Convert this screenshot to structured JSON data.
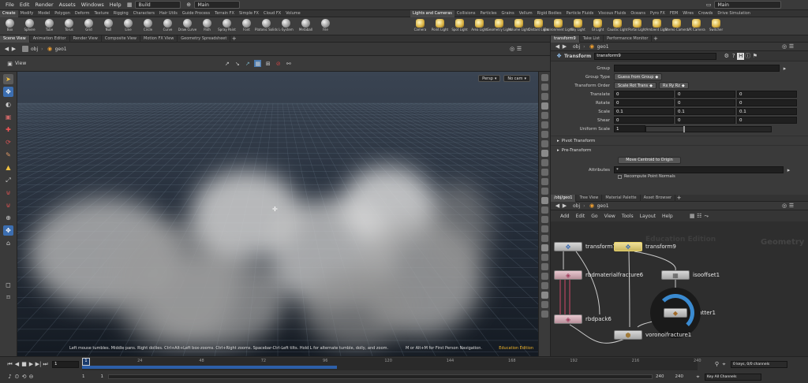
{
  "menubar": {
    "items": [
      "File",
      "Edit",
      "Render",
      "Assets",
      "Windows",
      "Help"
    ],
    "build": "Build",
    "desktop": "Main",
    "right_desktop": "Main"
  },
  "shelf": {
    "left_tabs": [
      "Create",
      "Modify",
      "Model",
      "Polygon",
      "Deform",
      "Texture",
      "Rigging",
      "Characters",
      "Hair Utils",
      "Guide Process",
      "Terrain FX",
      "Simple FX",
      "Cloud FX",
      "Volume"
    ],
    "right_tabs": [
      "Lights and Cameras",
      "Collisions",
      "Particles",
      "Grains",
      "Vellum",
      "Rigid Bodies",
      "Particle Fluids",
      "Viscous Fluids",
      "Oceans",
      "Pyro FX",
      "FEM",
      "Wires",
      "Crowds",
      "Drive Simulation"
    ],
    "left_tools": [
      "Box",
      "Sphere",
      "Tube",
      "Torus",
      "Grid",
      "Null",
      "Line",
      "Circle",
      "Curve",
      "Draw Curve",
      "Path",
      "Spray Paint",
      "Font",
      "Platonic Solids",
      "L-System",
      "Metaball",
      "File"
    ],
    "right_tools": [
      "Camera",
      "Point Light",
      "Spot Light",
      "Area Light",
      "Geometry Light",
      "Volume Light",
      "Distant Light",
      "Environment Light",
      "Sky Light",
      "GI Light",
      "Caustic Light",
      "Portal Light",
      "Ambient Light",
      "Stereo Camera",
      "VR Camera",
      "Switcher"
    ]
  },
  "left_panes": {
    "tabs": [
      "Scene View",
      "Animation Editor",
      "Render View",
      "Composite View",
      "Motion FX View",
      "Geometry Spreadsheet"
    ],
    "path": [
      "obj",
      "geo1"
    ]
  },
  "viewport": {
    "label": "View",
    "persp": "Persp",
    "cam": "No cam",
    "hint": "Left mouse tumbles. Middle pans. Right dollies. Ctrl+Alt+Left box-zooms. Ctrl+Right zooms. Spacebar-Ctrl-Left tilts. Hold L for alternate tumble, dolly, and zoom.",
    "hint2": "M or Alt+M for First Person Navigation.",
    "edition": "Education Edition"
  },
  "params_pane": {
    "tabs": [
      "transform9",
      "Take List",
      "Performance Monitor"
    ],
    "path": [
      "obj",
      "geo1"
    ],
    "node_type": "Transform",
    "node_name": "transform9",
    "group_label": "Group",
    "group_value": "",
    "group_type_label": "Group Type",
    "group_type_value": "Guess from Group",
    "order_label": "Transform Order",
    "order_value": "Scale Rot Trans",
    "rot_order": "Rx Ry Rz",
    "vectors": [
      {
        "label": "Translate",
        "x": "0",
        "y": "0",
        "z": "0"
      },
      {
        "label": "Rotate",
        "x": "0",
        "y": "0",
        "z": "0"
      },
      {
        "label": "Scale",
        "x": "0.1",
        "y": "0.1",
        "z": "0.1"
      },
      {
        "label": "Shear",
        "x": "0",
        "y": "0",
        "z": "0"
      }
    ],
    "uniform_label": "Uniform Scale",
    "uniform_value": "1",
    "uniform_level": 0.3,
    "pivot": "Pivot Transform",
    "pre": "Pre-Transform",
    "centroid_btn": "Move Centroid to Origin",
    "attributes_label": "Attributes",
    "attributes_value": "*",
    "recompute": "Recompute Point Normals"
  },
  "network_pane": {
    "tabs": [
      "/obj/geo1",
      "Tree View",
      "Material Palette",
      "Asset Browser"
    ],
    "path": [
      "obj",
      "geo1"
    ],
    "menu": [
      "Add",
      "Edit",
      "Go",
      "View",
      "Tools",
      "Layout",
      "Help"
    ],
    "watermark": "Education Edition",
    "watermark2": "Geometry",
    "nodes": [
      "transform7",
      "transform9",
      "rbdmaterialfracture6",
      "isooffset1",
      "scatter1",
      "rbdpack6",
      "voronoifracture1"
    ]
  },
  "timeline": {
    "frame": "1",
    "ticks": [
      "24",
      "48",
      "72",
      "96",
      "120",
      "144",
      "168",
      "192",
      "216",
      "240"
    ],
    "start": "1",
    "start2": "1",
    "end": "240",
    "end2": "240",
    "keys": "0 keys, 0/0 channels",
    "keyall": "Key All Channels",
    "current": "1"
  },
  "colors": {
    "accent": "#f0b429",
    "timeline_blue": "#2d5fa8",
    "node_selected": "#e8d36a"
  }
}
